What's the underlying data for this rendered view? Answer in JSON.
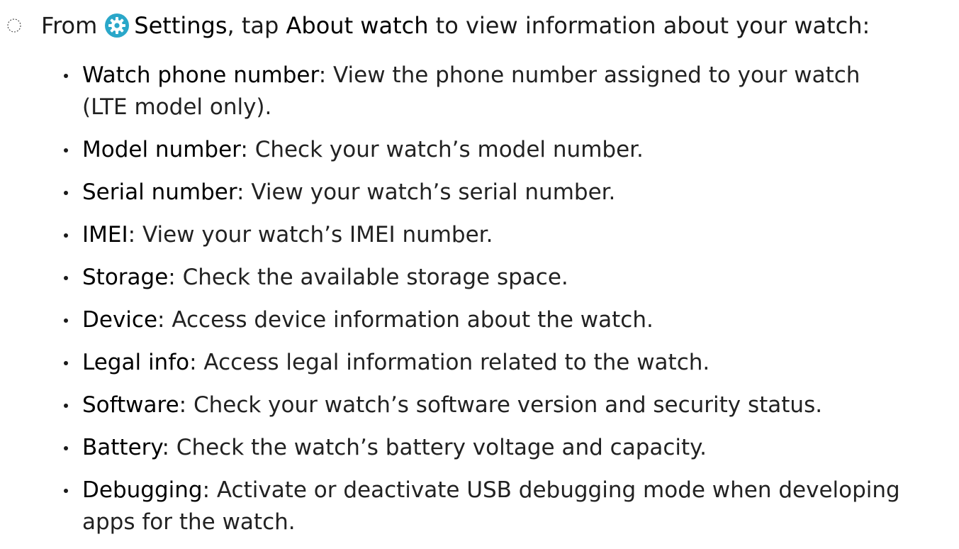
{
  "step": {
    "prefix": "From",
    "settings_label": "Settings",
    "middle": ", tap",
    "about_label": "About watch",
    "suffix": "to view information about your watch:",
    "icon": "settings-gear-icon",
    "icon_color": "#2aa7c9"
  },
  "items": [
    {
      "term": "Watch phone number",
      "sep": ":",
      "desc": "View the phone number assigned to your watch",
      "cont": "(LTE model only)."
    },
    {
      "term": "Model number",
      "sep": ":",
      "desc": "Check your watch’s model number."
    },
    {
      "term": "Serial number",
      "sep": ":",
      "desc": "View your watch’s serial number."
    },
    {
      "term": "IMEI",
      "sep": ":",
      "desc": "View your watch’s IMEI number."
    },
    {
      "term": "Storage",
      "sep": ":",
      "desc": "Check the available storage space."
    },
    {
      "term": "Device",
      "sep": ":",
      "desc": "Access device information about the watch."
    },
    {
      "term": "Legal info",
      "sep": ":",
      "desc": "Access legal information related to the watch."
    },
    {
      "term": "Software",
      "sep": ":",
      "desc": "Check your watch’s software version and security status."
    },
    {
      "term": "Battery",
      "sep": ":",
      "desc": "Check the watch’s battery voltage and capacity."
    },
    {
      "term": "Debugging",
      "sep": ":",
      "desc": "Activate or deactivate USB debugging mode when developing",
      "cont": "apps for the watch."
    }
  ]
}
